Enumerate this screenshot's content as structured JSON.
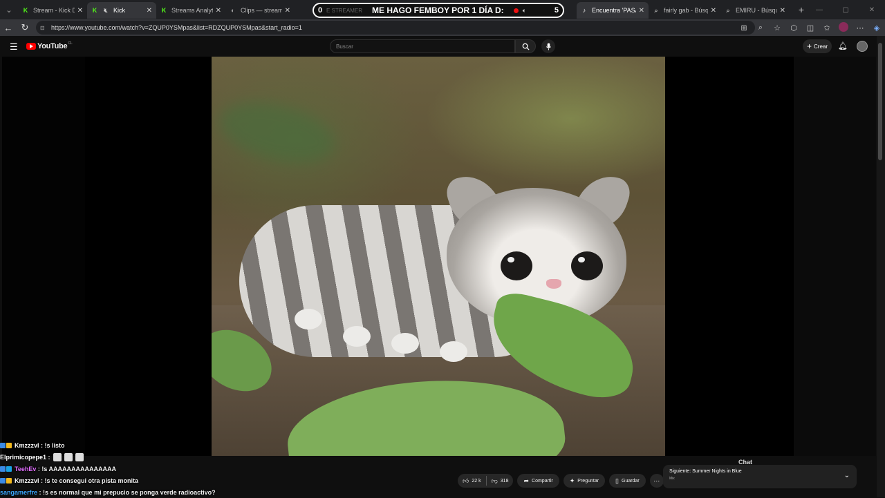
{
  "tabs": [
    {
      "label": "Stream - Kick Dash",
      "icon": "kick-icon"
    },
    {
      "label": "Kick",
      "icon": "kick-icon",
      "muted": true
    },
    {
      "label": "Streams Analytics",
      "icon": "kick-icon"
    },
    {
      "label": "Clips — streamer",
      "icon": "globe-icon"
    },
    {
      "label": "Encuentra 'PASAN",
      "icon": "tiktok-icon"
    },
    {
      "label": "fairly gab - Búsqueda",
      "icon": "search-icon"
    },
    {
      "label": "EMIRU - Búsqueda",
      "icon": "search-icon"
    }
  ],
  "overlay_banner": {
    "count_left": "0",
    "faded_text": "E STREAMER",
    "headline": "ME HAGO FEMBOY POR 1 DÍA D:",
    "count_right": "5"
  },
  "browser": {
    "url": "https://www.youtube.com/watch?v=ZQUP0YSMpas&list=RDZQUP0YSMpas&start_radio=1",
    "chat_label": "Chat"
  },
  "youtube": {
    "logo_text": "YouTube",
    "country_code": "CL",
    "search_placeholder": "Buscar",
    "create_label": "Crear"
  },
  "actions": {
    "likes": "22 k",
    "dislikes": "318",
    "share": "Compartir",
    "ask": "Preguntar",
    "save": "Guardar"
  },
  "up_next": {
    "prefix": "Siguiente:",
    "title": "Summer Nights in Blue",
    "subtitle": "Mix"
  },
  "chat": [
    {
      "user": "Kmzzzvl",
      "message": ": !s listo",
      "color": "#ffffff"
    },
    {
      "user": "Elprimicopepe1",
      "message": ":",
      "color": "#ffffff",
      "emotes": 3
    },
    {
      "user": "TeehEv",
      "message": ": !s AAAAAAAAAAAAAAA",
      "color": "#e06cff"
    },
    {
      "user": "Kmzzzvl",
      "message": ": !s te consegui otra pista monita",
      "color": "#ffffff"
    },
    {
      "user": "sangamerfre",
      "message": ": !s es normal que mi prepucio se ponga verde radioactivo?",
      "color": "#3da8ff"
    }
  ]
}
